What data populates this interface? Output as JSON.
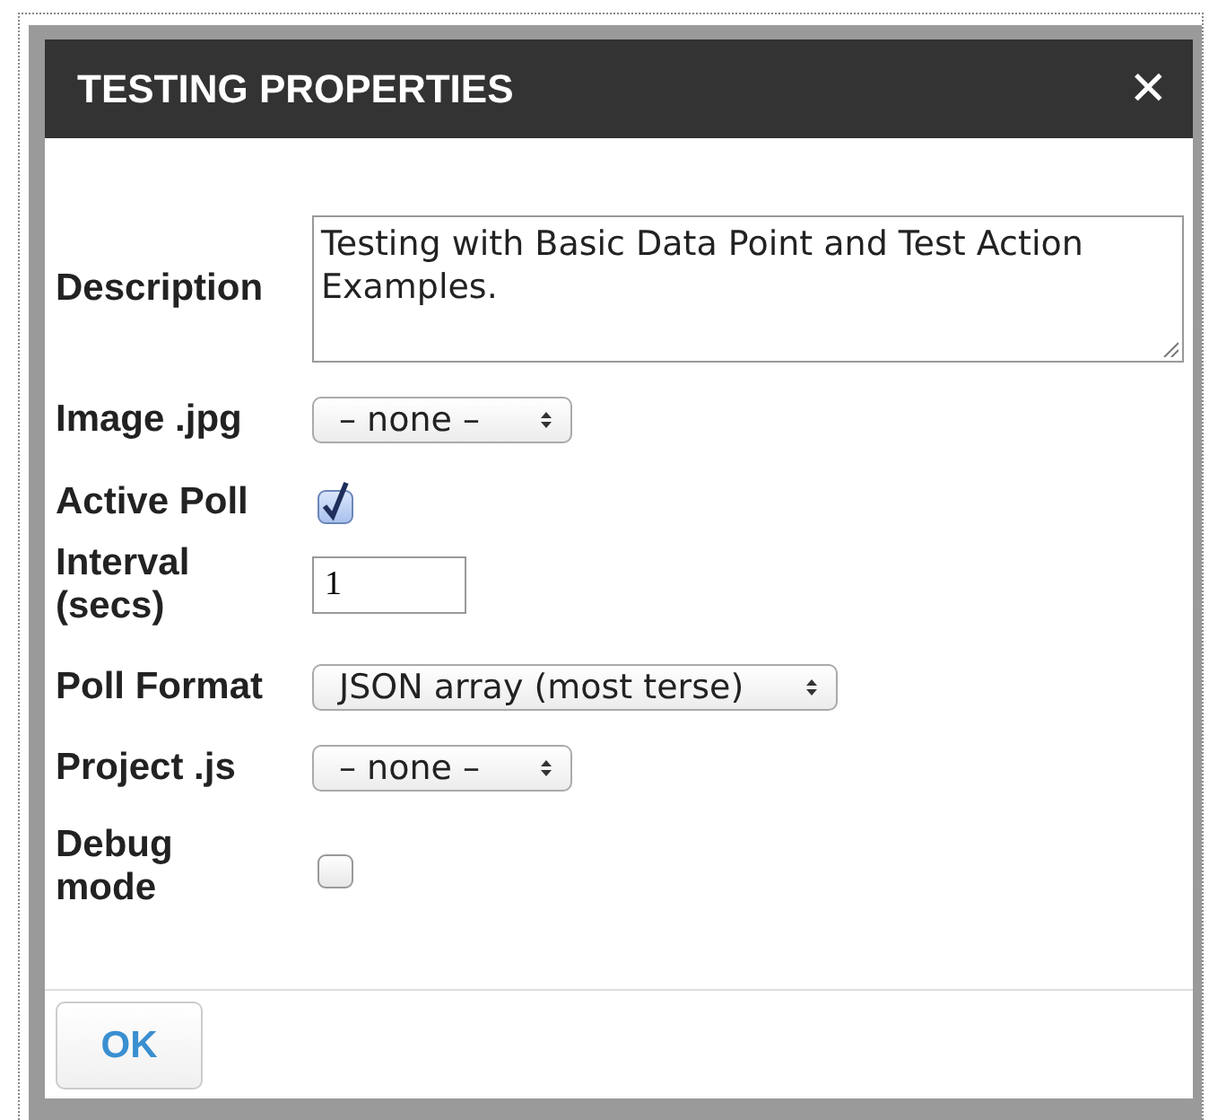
{
  "dialog": {
    "title": "TESTING PROPERTIES",
    "close": "✕"
  },
  "fields": [
    {
      "kind": "textarea",
      "label": "Description",
      "value": "Testing with Basic Data Point and Test Action Examples."
    },
    {
      "kind": "select",
      "label": "Image .jpg",
      "value": "– none –"
    },
    {
      "kind": "checkbox",
      "label": "Active Poll",
      "checked": true
    },
    {
      "kind": "text",
      "label": "Interval\n(secs)",
      "value": "1"
    },
    {
      "kind": "select",
      "label": "Poll Format",
      "value": "JSON array (most terse)"
    },
    {
      "kind": "select",
      "label": "Project .js",
      "value": "– none –"
    },
    {
      "kind": "checkbox",
      "label": "Debug\nmode",
      "checked": false
    }
  ],
  "buttons": [
    {
      "label": "OK"
    }
  ]
}
